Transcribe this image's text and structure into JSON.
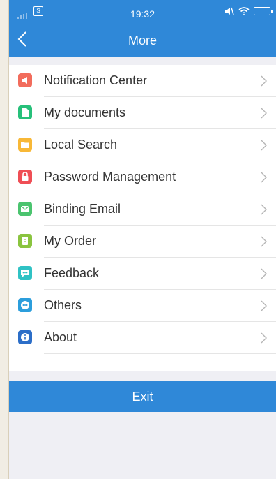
{
  "status": {
    "time": "19:32",
    "sim": "S"
  },
  "header": {
    "title": "More"
  },
  "menu": [
    {
      "label": "Notification Center",
      "icon": "megaphone-icon",
      "color": "#f26c5c"
    },
    {
      "label": "My documents",
      "icon": "document-icon",
      "color": "#27c07a"
    },
    {
      "label": "Local Search",
      "icon": "folder-icon",
      "color": "#f8b837"
    },
    {
      "label": "Password Management",
      "icon": "lock-icon",
      "color": "#ef4e55"
    },
    {
      "label": "Binding Email",
      "icon": "envelope-icon",
      "color": "#4bc46f"
    },
    {
      "label": "My Order",
      "icon": "order-icon",
      "color": "#8ac43f"
    },
    {
      "label": "Feedback",
      "icon": "chat-bubble-icon",
      "color": "#2fc2c4"
    },
    {
      "label": "Others",
      "icon": "more-dots-icon",
      "color": "#2c9edc"
    },
    {
      "label": "About",
      "icon": "info-icon",
      "color": "#2c6ec8"
    }
  ],
  "exit": {
    "label": "Exit"
  },
  "colors": {
    "accent": "#2f88d8",
    "background": "#efeff4"
  }
}
